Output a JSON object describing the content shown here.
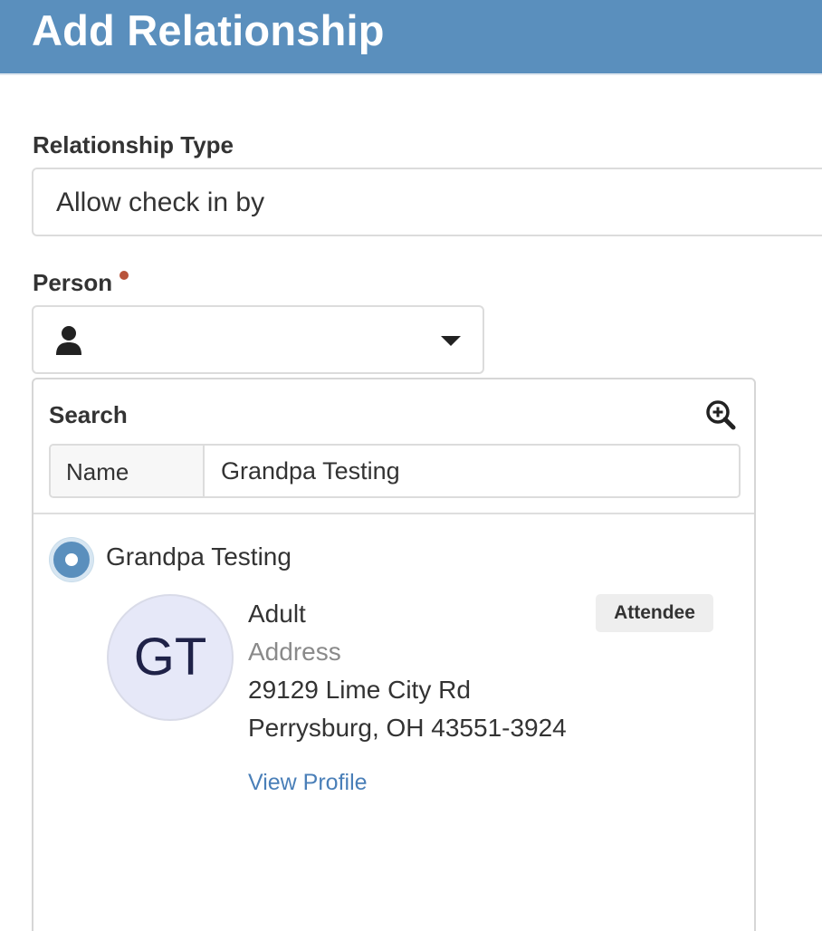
{
  "header": {
    "title": "Add Relationship"
  },
  "form": {
    "relationship_type": {
      "label": "Relationship Type",
      "value": "Allow check in by"
    },
    "person": {
      "label": "Person",
      "required": true,
      "icon": "person-icon",
      "caret": "caret-down-icon"
    }
  },
  "search_panel": {
    "title": "Search",
    "advanced_icon": "zoom-in-icon",
    "field_label": "Name",
    "field_value": "Grandpa Testing"
  },
  "result": {
    "selected": true,
    "name": "Grandpa Testing",
    "initials": "GT",
    "age_class": "Adult",
    "address_label": "Address",
    "address_line1": "29129 Lime City Rd",
    "address_line2": "Perrysburg, OH 43551-3924",
    "badge": "Attendee",
    "view_profile": "View Profile"
  },
  "colors": {
    "header_bg": "#5a8fbd",
    "accent": "#5a8fbd",
    "link": "#4a7fb8",
    "required": "#b8533a",
    "avatar_bg": "#e6e8f8"
  }
}
